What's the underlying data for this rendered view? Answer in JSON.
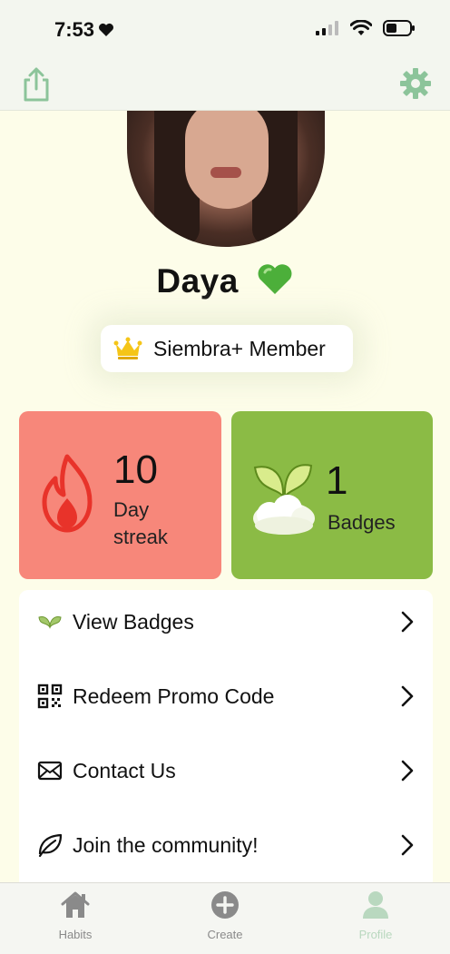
{
  "status_bar": {
    "time": "7:53",
    "time_icon": "heart-icon",
    "icons": [
      "signal-icon",
      "wifi-icon",
      "battery-icon"
    ]
  },
  "top_nav": {
    "left_icon": "share-icon",
    "right_icon": "gear-icon",
    "accent_color": "#8cc49a"
  },
  "profile": {
    "name": "Daya",
    "name_emoji": "green-heart-icon",
    "membership": "Siembra+ Member",
    "membership_icon": "crown-icon"
  },
  "stats": {
    "streak": {
      "value": "10",
      "label_line1": "Day",
      "label_line2": "streak",
      "icon": "flame-icon",
      "color": "#f7877a"
    },
    "badges": {
      "value": "1",
      "label": "Badges",
      "icon": "sprout-cloud-icon",
      "color": "#8bbb45"
    }
  },
  "menu": {
    "items": [
      {
        "label": "View Badges",
        "icon": "leaf-icon"
      },
      {
        "label": "Redeem Promo Code",
        "icon": "qr-code-icon"
      },
      {
        "label": "Contact Us",
        "icon": "envelope-icon"
      },
      {
        "label": "Join the community!",
        "icon": "leaf-outline-icon"
      }
    ]
  },
  "tab_bar": {
    "tabs": [
      {
        "label": "Habits",
        "icon": "house-icon"
      },
      {
        "label": "Create",
        "icon": "plus-circle-icon"
      },
      {
        "label": "Profile",
        "icon": "person-icon",
        "active": true
      }
    ],
    "active_color": "#b9d8bf"
  }
}
